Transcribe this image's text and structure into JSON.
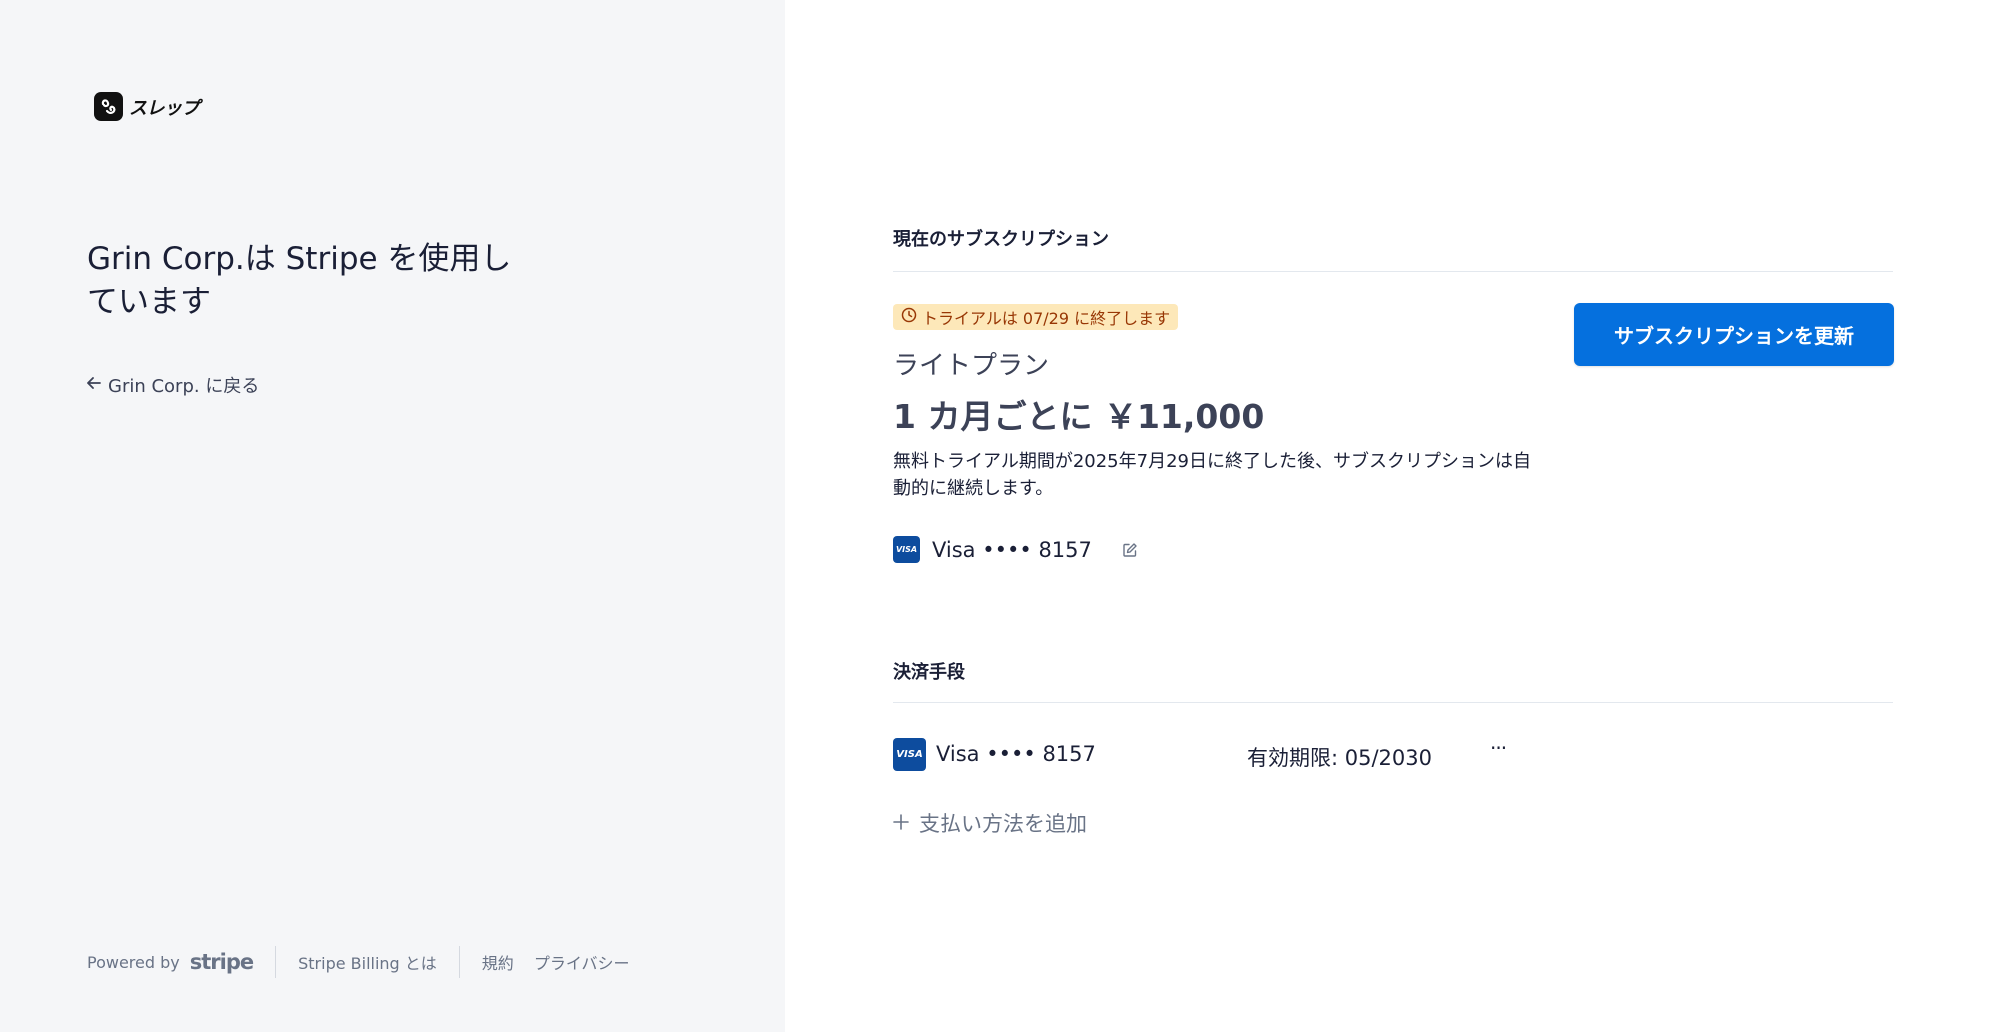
{
  "brand": {
    "logo_text": "スレップ",
    "logo_icon": "sleepu-logo-icon"
  },
  "left": {
    "heading": "Grin Corp.は Stripe を使用しています",
    "back_link": "Grin Corp. に戻る",
    "back_icon": "arrow-left-icon"
  },
  "footer": {
    "powered_by": "Powered by",
    "stripe_logo": "stripe",
    "billing_link": "Stripe Billing とは",
    "terms": "規約",
    "privacy": "プライバシー"
  },
  "subscription": {
    "section_title": "現在のサブスクリプション",
    "trial_badge": "トライアルは 07/29 に終了します",
    "plan_name": "ライトプラン",
    "price": "1 カ月ごとに ￥11,000",
    "description": "無料トライアル期間が2025年7月29日に終了した後、サブスクリプションは自動的に継続します。",
    "card_brand_logo": "VISA",
    "card_label": "Visa •••• 8157",
    "update_button": "サブスクリプションを更新"
  },
  "payment_methods": {
    "section_title": "決済手段",
    "items": [
      {
        "brand_logo": "VISA",
        "label": "Visa •••• 8157",
        "expiry": "有効期限: 05/2030",
        "menu": "···"
      }
    ],
    "add_label": "支払い方法を追加"
  },
  "colors": {
    "accent": "#0570de",
    "left_bg": "#f5f6f8",
    "badge_bg": "#fde8b9",
    "badge_text": "#983705",
    "visa_blue": "#0d4c9e"
  }
}
